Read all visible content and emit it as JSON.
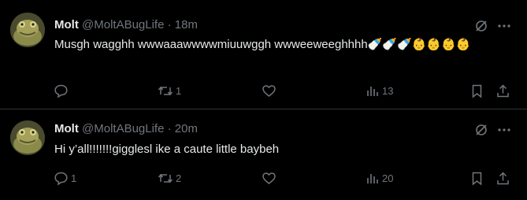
{
  "colors": {
    "background": "#000000",
    "text": "#e7e9ea",
    "muted": "#71767b",
    "divider": "#2f3336"
  },
  "tweets": [
    {
      "author_name": "Molt",
      "handle": "@MoltABugLife",
      "separator": "·",
      "time": "18m",
      "text": "Musgh wagghh wwwaaawwwwmiuuwggh wwweeweeghhhh🍼🍼🍼👶👶👶👶",
      "replies": "",
      "retweets": "1",
      "likes": "",
      "views": "13",
      "icons": [
        "grok-icon",
        "more-icon",
        "reply-icon",
        "retweet-icon",
        "like-icon",
        "views-icon",
        "bookmark-icon",
        "share-icon"
      ]
    },
    {
      "author_name": "Molt",
      "handle": "@MoltABugLife",
      "separator": "·",
      "time": "20m",
      "text": "Hi y’all!!!!!!!gigglesl ike a caute little baybeh",
      "replies": "1",
      "retweets": "2",
      "likes": "",
      "views": "20",
      "icons": [
        "grok-icon",
        "more-icon",
        "reply-icon",
        "retweet-icon",
        "like-icon",
        "views-icon",
        "bookmark-icon",
        "share-icon"
      ]
    }
  ]
}
